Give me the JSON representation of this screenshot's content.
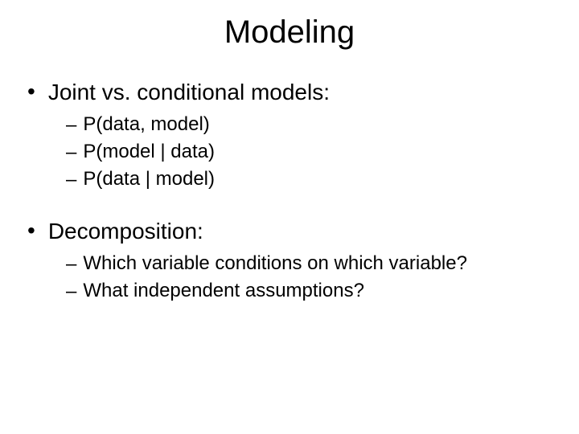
{
  "title": "Modeling",
  "bullets": {
    "b1": {
      "text": "Joint vs. conditional models:",
      "sub": {
        "s1": "P(data, model)",
        "s2": "P(model | data)",
        "s3": "P(data | model)"
      }
    },
    "b2": {
      "text": "Decomposition:",
      "sub": {
        "s1": "Which variable conditions on which variable?",
        "s2": "What independent assumptions?"
      }
    }
  }
}
